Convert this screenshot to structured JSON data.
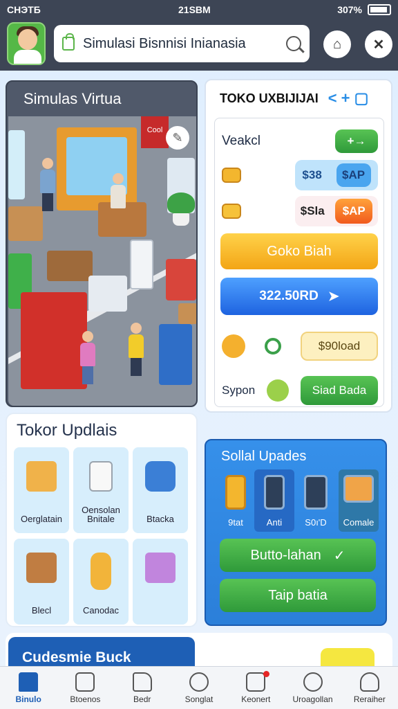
{
  "status_bar": {
    "carrier": "CHЭТБ",
    "time": "21SBM",
    "battery": "307%"
  },
  "header": {
    "search_text": "Simulasi Bisnnisi Inianasia"
  },
  "simulator": {
    "title": "Simulas Virtua",
    "shop_sign": "Cool"
  },
  "store_panel": {
    "title": "TOKO UXBIJIJAI",
    "title_icon": "< + ▢",
    "item_label": "Veakcl",
    "add_button": "+→",
    "price1": "$38",
    "price1_tag": "$AP",
    "price2": "$Sla",
    "price2_tag": "$AP",
    "buy_button": "Goko Biah",
    "balance_button": "322.50RD",
    "download_button": "$90load",
    "sponsor_label": "Sypon",
    "start_button": "Siad Bada"
  },
  "updates": {
    "title": "Tokor Updlais",
    "tiles": [
      {
        "label": "Oerglatain",
        "icon": "box-icon",
        "color": "#f0b24a"
      },
      {
        "label": "Oensolan Bnitale",
        "icon": "receipt-icon",
        "color": "#f8f8f8"
      },
      {
        "label": "Btacka",
        "icon": "cooler-icon",
        "color": "#3b7fd6"
      },
      {
        "label": "Blecl",
        "icon": "open-box-icon",
        "color": "#c07d42"
      },
      {
        "label": "Canodac",
        "icon": "bottle-icon",
        "color": "#f2b43a"
      },
      {
        "label": "",
        "icon": "package-icon",
        "color": "#c185dd"
      }
    ]
  },
  "special": {
    "title": "Sollal Upades",
    "items": [
      {
        "label": "9tat",
        "icon": "smart-tag-icon"
      },
      {
        "label": "Anti",
        "icon": "phone-icon"
      },
      {
        "label": "S0ı'D",
        "icon": "tablet-icon"
      },
      {
        "label": "Comale",
        "icon": "monitor-icon"
      }
    ],
    "primary_button": "Butto-lahan",
    "secondary_button": "Taip batia"
  },
  "bottom_section": {
    "title": "Cudesmie Buck"
  },
  "tabs": [
    {
      "label": "Binulo",
      "icon": "home-icon",
      "active": true
    },
    {
      "label": "Btoenos",
      "icon": "bag-icon",
      "active": false
    },
    {
      "label": "Bedr",
      "icon": "tag-icon",
      "active": false
    },
    {
      "label": "Songlat",
      "icon": "gauge-icon",
      "active": false
    },
    {
      "label": "Keonert",
      "icon": "chart-icon",
      "active": false,
      "badge": true
    },
    {
      "label": "Uroagollan",
      "icon": "settings-icon",
      "active": false
    },
    {
      "label": "Reraiher",
      "icon": "user-icon",
      "active": false
    }
  ]
}
